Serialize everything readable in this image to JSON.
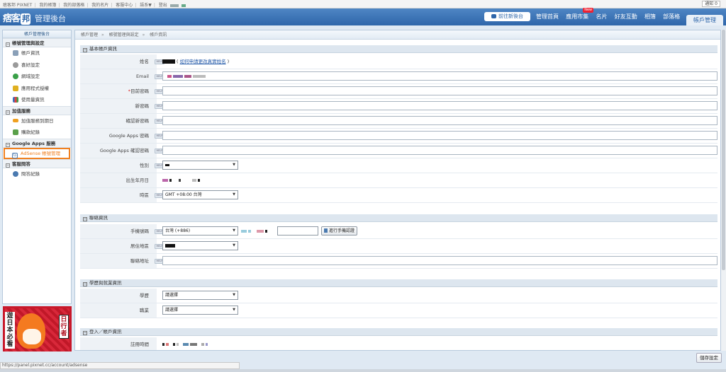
{
  "toplinks": {
    "items": [
      "痞客邦 PIXNET",
      "我的帳簿",
      "我的部落格",
      "我的名片",
      "客服中心",
      "語系▼",
      "登出"
    ],
    "notice": "通知 0"
  },
  "header": {
    "logo_text": "痞客",
    "logo_badge": "邦",
    "subtitle": "管理後台",
    "goto_new": "前往新後台",
    "nav": [
      "管理首頁",
      "應用市集",
      "名片",
      "好友互動",
      "相簿",
      "部落格"
    ],
    "new_badge": "New",
    "active_tab": "帳戶管理"
  },
  "sidebar": {
    "title": "帳戶管理後台",
    "groups": [
      {
        "label": "帳號管理與設定",
        "items": [
          "帳戶資訊",
          "喜好設定",
          "網域設定",
          "應用程式授權",
          "使用量資訊"
        ]
      },
      {
        "label": "加值服務",
        "items": [
          "加值服務到期日",
          "購款紀錄"
        ]
      },
      {
        "label": "Google Apps 服務",
        "items": [
          "AdSense 帳號管理"
        ]
      },
      {
        "label": "客服問答",
        "items": [
          "問答紀錄"
        ]
      }
    ]
  },
  "promo": {
    "left_text": "遊日本必看",
    "right_text": "日行者"
  },
  "breadcrumb": [
    "帳戶管理",
    "帳號管理與設定",
    "帳戶資訊"
  ],
  "help_label": "HELP",
  "sections": {
    "basic": {
      "title": "基本帳戶資訊",
      "name_label": "姓名",
      "name_link": "如何申請更改真實姓名",
      "email_label": "Email",
      "current_pw_label": "目前密碼",
      "new_pw_label": "新密碼",
      "confirm_pw_label": "確認新密碼",
      "gapps_pw_label": "Google Apps 密碼",
      "gapps_confirm_label": "Google Apps 確認密碼",
      "gender_label": "性別",
      "birthday_label": "出生年月日",
      "timezone_label": "時區",
      "timezone_value": "GMT +08:00 台灣"
    },
    "contact": {
      "title": "聯絡資訊",
      "phone_label": "手機號碼",
      "phone_country": "台灣 (+886)",
      "verify_button": "進行手機認證",
      "region_label": "居住地區",
      "address_label": "聯絡地址"
    },
    "education": {
      "title": "學歷與就業資訊",
      "degree_label": "學歷",
      "degree_value": "請選擇",
      "job_label": "職業",
      "job_value": "請選擇"
    },
    "login": {
      "title": "登入／帳戶資訊",
      "register_label": "註冊時間"
    }
  },
  "save_button": "儲存設定",
  "status_url": "https://panel.pixnet.cc/account/adsense"
}
